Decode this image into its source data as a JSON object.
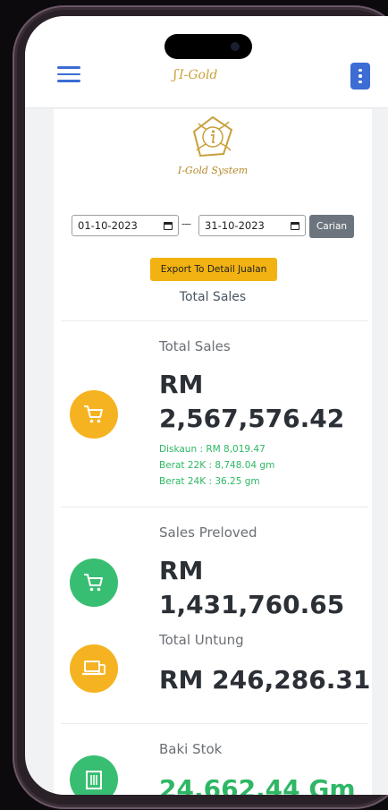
{
  "header": {
    "app_logo_text": "I-Gold",
    "menu_icon": "hamburger-icon",
    "more_icon": "kebab-menu-icon"
  },
  "brand": {
    "name": "I-Gold System"
  },
  "filter": {
    "date_from": "01-10-2023",
    "separator": "---",
    "date_to": "31-10-2023",
    "search_label": "Carian"
  },
  "export_label": "Export To Detail Jualan",
  "section_title": "Total Sales",
  "stats": {
    "total_sales": {
      "label": "Total Sales",
      "currency": "RM",
      "amount": "2,567,576.42",
      "diskaun": "Diskaun : RM 8,019.47",
      "berat22k": "Berat 22K : 8,748.04 gm",
      "berat24k": "Berat 24K : 36.25 gm",
      "icon": "cart-icon"
    },
    "sales_preloved": {
      "label": "Sales Preloved",
      "currency": "RM",
      "amount": "1,431,760.65",
      "icon": "cart-icon"
    },
    "total_untung": {
      "label": "Total Untung",
      "value": "RM 246,286.31",
      "icon": "laptop-icon"
    },
    "baki_stok": {
      "label": "Baki Stok",
      "value": "24,662.44 Gm",
      "icon": "building-icon"
    }
  },
  "colors": {
    "accent_blue": "#3c6cd4",
    "gold": "#c9a13a",
    "yellow": "#f6b321",
    "green": "#38be72"
  }
}
